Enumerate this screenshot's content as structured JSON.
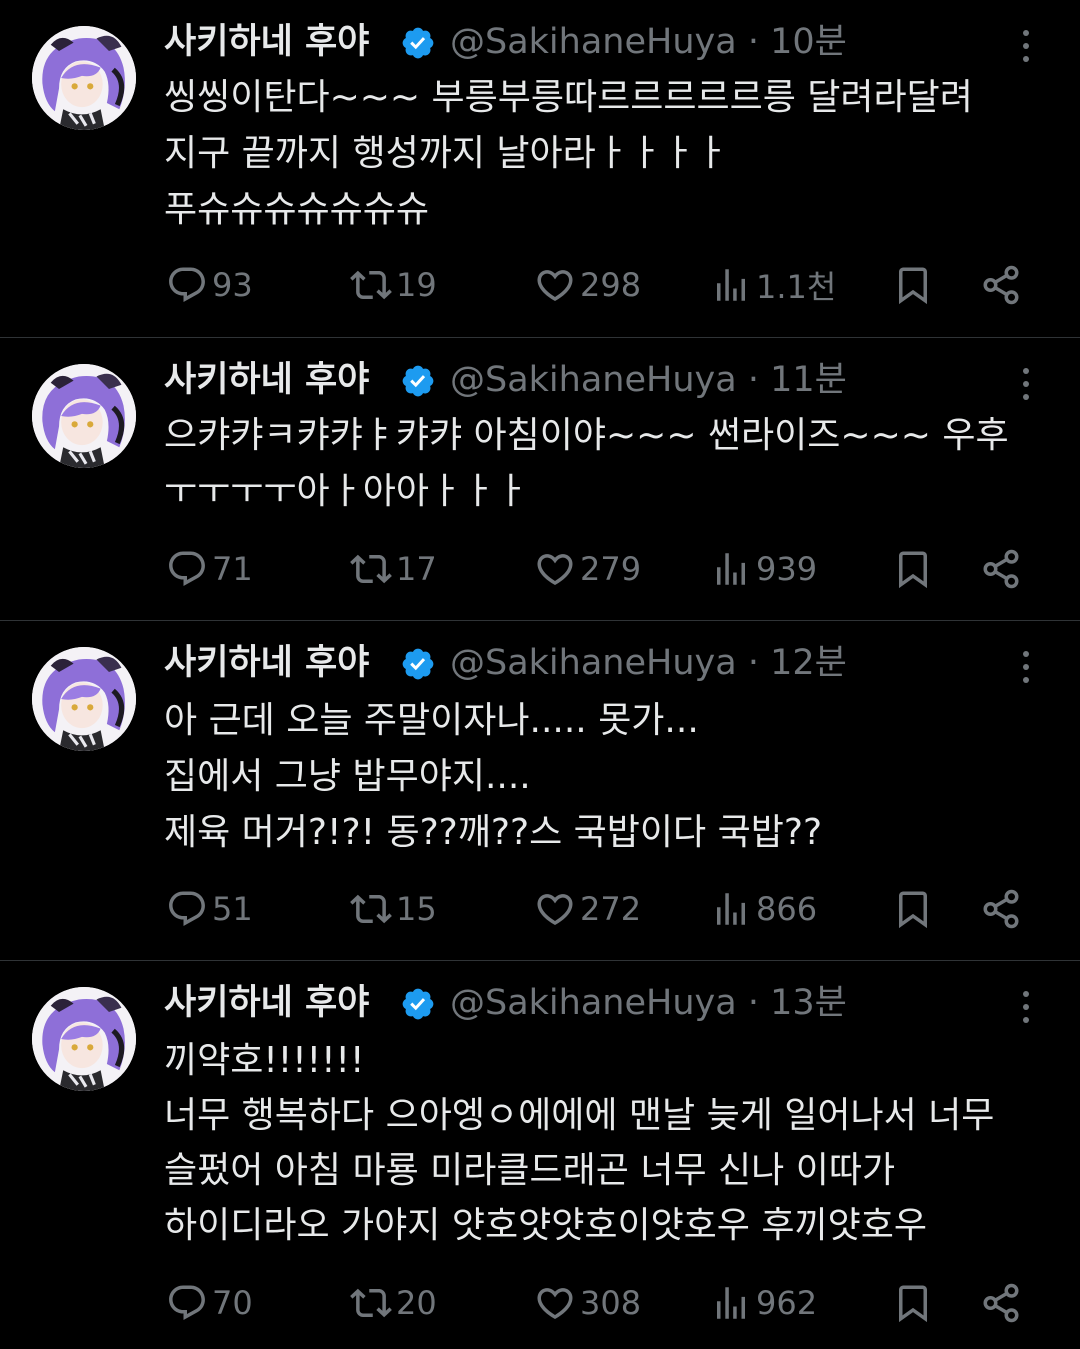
{
  "tweets": [
    {
      "name": "사키하네 후야",
      "handle": "@SakihaneHuya",
      "time": "· 10분",
      "lines": [
        "씽씽이탄다~~~ 부릉부릉따르르르르르릉 달려라달려",
        "지구 끝까지 행성까지 날아라ㅏㅏㅏㅏ",
        "푸슈슈슈슈슈슈슈"
      ],
      "replies": "93",
      "retweets": "19",
      "likes": "298",
      "views": "1.1천"
    },
    {
      "name": "사키하네 후야",
      "handle": "@SakihaneHuya",
      "time": "· 11분",
      "lines": [
        "으캬캬ㅋ캬캬ㅑ캬캬 아침이야~~~ 썬라이즈~~~ 우후",
        "ㅜㅜㅜㅜ아ㅏ아아ㅏㅏㅏ"
      ],
      "replies": "71",
      "retweets": "17",
      "likes": "279",
      "views": "939"
    },
    {
      "name": "사키하네 후야",
      "handle": "@SakihaneHuya",
      "time": "· 12분",
      "lines": [
        "아 근데 오늘 주말이자나..... 못가...",
        "집에서 그냥 밥무야지....",
        "제육 머거?!?! 동??깨??스 국밥이다 국밥??"
      ],
      "replies": "51",
      "retweets": "15",
      "likes": "272",
      "views": "866"
    },
    {
      "name": "사키하네 후야",
      "handle": "@SakihaneHuya",
      "time": "· 13분",
      "lines": [
        "끼약호!!!!!!!",
        "너무 행복하다 으아엥ㅇ에에에 맨날 늦게 일어나서 너무",
        "슬펐어 아침 마룡 미라클드래곤 너무 신나 이따가",
        "하이디라오 가야지 얏호얏얏호이얏호우 후끼얏호우"
      ],
      "replies": "70",
      "retweets": "20",
      "likes": "308",
      "views": "962"
    }
  ],
  "colors": {
    "background": "#000000",
    "text": "#e7e9ea",
    "muted": "#71767b",
    "verified": "#1d9bf0",
    "divider": "#2f3336",
    "avatar_hair": "#8e6fd8"
  },
  "icons": [
    "reply-icon",
    "retweet-icon",
    "like-icon",
    "views-icon",
    "bookmark-icon",
    "share-icon",
    "verified-badge-icon",
    "more-icon"
  ]
}
